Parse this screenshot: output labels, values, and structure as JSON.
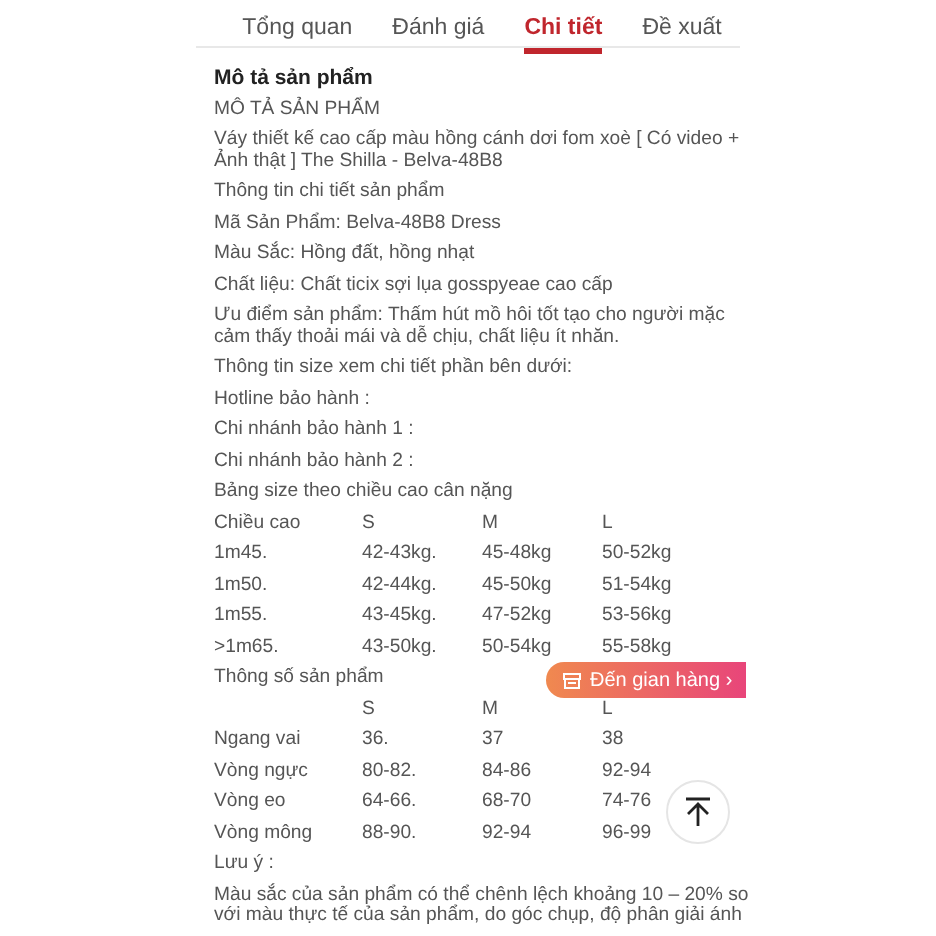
{
  "tabs": [
    {
      "label": "Tổng quan",
      "selected": false
    },
    {
      "label": "Đánh giá",
      "selected": false
    },
    {
      "label": "Chi tiết",
      "selected": true
    },
    {
      "label": "Đề xuất",
      "selected": false
    }
  ],
  "section_title": "Mô tả sản phẩm",
  "paragraphs_top": [
    "MÔ TẢ SẢN PHẨM",
    "Váy thiết kế cao cấp màu hồng cánh dơi fom xoè [ Có video + Ảnh thật ] The Shilla - Belva-48B8",
    "Thông tin chi tiết sản phẩm",
    "Mã Sản Phẩm: Belva-48B8 Dress",
    "Màu Sắc: Hồng đất, hồng nhạt",
    "Chất liệu: Chất ticix sợi lụa gosspyeae cao cấp",
    "Ưu điểm sản phẩm: Thấm hút mồ hôi tốt tạo cho người mặc cảm thấy thoải mái và dễ chịu, chất liệu ít nhăn.",
    "Thông tin size xem chi tiết phần bên dưới:",
    "Hotline bảo hành :",
    "Chi nhánh bảo hành 1 :",
    "Chi nhánh bảo hành 2 :",
    "Bảng size theo chiều cao cân nặng"
  ],
  "size_table": {
    "header": [
      "Chiều cao",
      "S",
      "M",
      "L"
    ],
    "rows": [
      [
        "1m45.",
        "42-43kg.",
        "45-48kg",
        "50-52kg"
      ],
      [
        "1m50.",
        "42-44kg.",
        "45-50kg",
        "51-54kg"
      ],
      [
        "1m55.",
        "43-45kg.",
        "47-52kg",
        "53-56kg"
      ],
      [
        ">1m65.",
        "43-50kg.",
        "50-54kg",
        "55-58kg"
      ]
    ]
  },
  "spec_title": "Thông số sản phẩm",
  "spec_table": {
    "header": [
      "S",
      "M",
      "L"
    ],
    "rows": [
      [
        "Ngang vai",
        "36.",
        "37",
        "38"
      ],
      [
        "Vòng ngực",
        "80-82.",
        "84-86",
        "92-94"
      ],
      [
        "Vòng eo",
        "64-66.",
        "68-70",
        "74-76"
      ],
      [
        "Vòng mông",
        "88-90.",
        "92-94",
        "96-99"
      ]
    ]
  },
  "paragraphs_bottom": [
    "Lưu ý :",
    "Màu sắc của sản phẩm có thể chênh lệch khoảng 10 – 20% so với màu thực tế của sản phẩm, do góc chụp, độ phân giải ánh"
  ],
  "shop_button": {
    "label": "Đến gian hàng ›"
  }
}
